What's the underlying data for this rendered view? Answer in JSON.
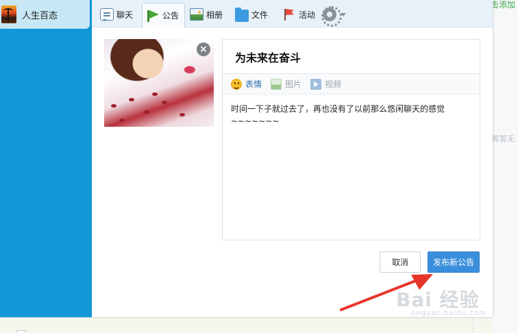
{
  "group": {
    "name": "人生百态"
  },
  "tabs": [
    {
      "label": "聊天",
      "icon": "chat-icon"
    },
    {
      "label": "公告",
      "icon": "notice-flag-icon",
      "active": true
    },
    {
      "label": "相册",
      "icon": "album-icon"
    },
    {
      "label": "文件",
      "icon": "folder-icon"
    },
    {
      "label": "活动",
      "icon": "event-flag-icon"
    }
  ],
  "settings": {
    "icon": "gear-icon",
    "dropdown_icon": "chevron-down-icon"
  },
  "notice": {
    "title": "为未来在奋斗",
    "tools": {
      "emoji": "表情",
      "image": "图片",
      "video": "视频"
    },
    "body_lines": [
      "时间一下子就过去了，再也没有了以前那么悠闲聊天的感觉",
      "~~~~~~~"
    ]
  },
  "buttons": {
    "cancel": "取消",
    "publish": "发布新公告"
  },
  "right_partial": {
    "top_link": "击添加",
    "hint": "库暂无"
  },
  "watermark": {
    "main": "Bai 经验",
    "sub": "jingyan.baidu.com"
  },
  "colors": {
    "sidebar": "#0f97d6",
    "primary": "#3a8fdc",
    "arrow": "#e8352c",
    "link": "#2a6fb0"
  }
}
